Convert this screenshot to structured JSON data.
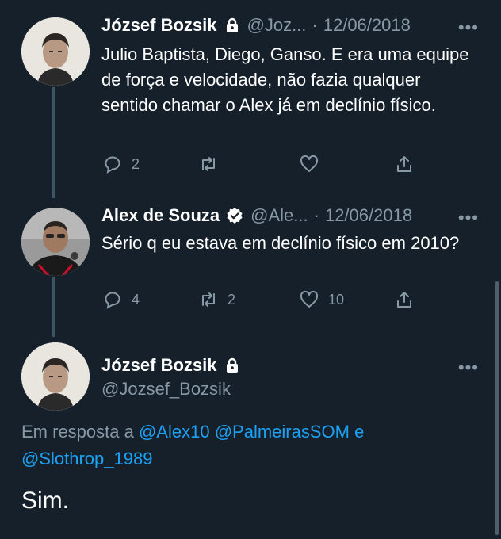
{
  "tweets": [
    {
      "name": "József Bozsik",
      "handle": "@Joz...",
      "separator": "·",
      "date": "12/06/2018",
      "text": "Julio Baptista, Diego, Ganso. E era uma equipe de força e velocidade, não fazia qualquer sentido chamar o Alex já em declínio físico.",
      "replies": "2",
      "retweets": "",
      "likes": "",
      "icons": [
        "lock-icon"
      ]
    },
    {
      "name": "Alex de Souza",
      "handle": "@Ale...",
      "separator": "·",
      "date": "12/06/2018",
      "text": "Sério q eu estava em declínio físico em 2010?",
      "replies": "4",
      "retweets": "2",
      "likes": "10",
      "icons": [
        "verified-icon"
      ]
    }
  ],
  "main_tweet": {
    "name": "József Bozsik",
    "handle": "@Jozsef_Bozsik",
    "reply_prefix": "Em resposta a",
    "mention_1": "@Alex10",
    "mention_2": "@PalmeirasSOM",
    "conjunction": "e",
    "mention_3": "@Slothrop_1989",
    "text": "Sim."
  },
  "more_label": "•••",
  "colors": {
    "background": "#15202b",
    "text": "#ffffff",
    "muted": "#8899a6",
    "link": "#1da1f2",
    "thread_line": "#3d5466"
  }
}
